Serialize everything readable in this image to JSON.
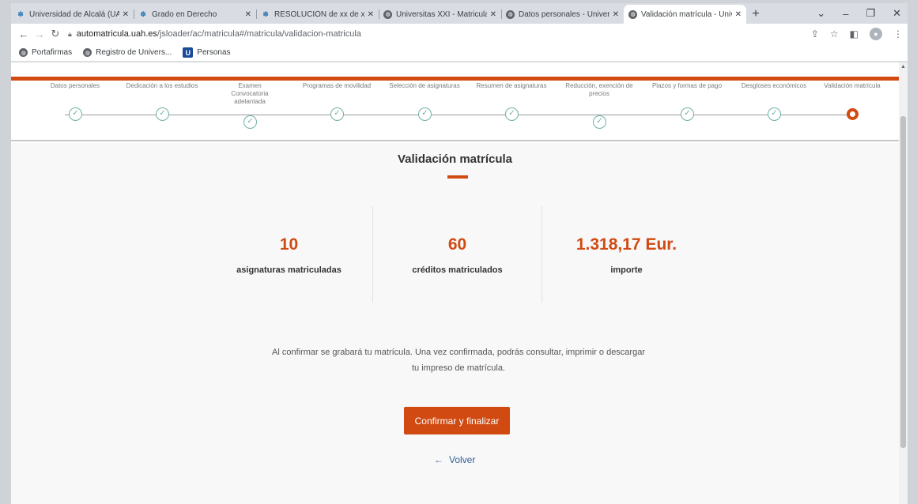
{
  "browser": {
    "tabs": [
      {
        "title": "Universidad de Alcalá (UAH) |",
        "icon": "uah-logo-icon",
        "active": false
      },
      {
        "title": "Grado en Derecho",
        "icon": "uah-logo-icon",
        "active": false
      },
      {
        "title": "RESOLUCIÓN de xx de xx de",
        "icon": "uah-logo-icon",
        "active": false
      },
      {
        "title": "Universitas XXI - Matricula W",
        "icon": "globe-icon",
        "active": false
      },
      {
        "title": "Datos personales - Universit",
        "icon": "globe-icon",
        "active": false
      },
      {
        "title": "Validación matrícula - Univer",
        "icon": "globe-icon",
        "active": true
      }
    ],
    "url_host": "automatricula.uah.es",
    "url_path": "/jsloader/ac/matricula#/matricula/validacion-matricula",
    "bookmarks": [
      {
        "label": "Portafirmas",
        "icon": "globe-icon"
      },
      {
        "label": "Registro de Univers...",
        "icon": "globe-icon"
      },
      {
        "label": "Personas",
        "icon": "u-logo-icon"
      }
    ]
  },
  "steps": [
    {
      "label": "Datos personales",
      "status": "done"
    },
    {
      "label": "Dedicación a los estudios",
      "status": "done"
    },
    {
      "label": "Examen Convocatoria adelantada",
      "status": "done"
    },
    {
      "label": "Programas de movilidad",
      "status": "done"
    },
    {
      "label": "Selección de asignaturas",
      "status": "done"
    },
    {
      "label": "Resumen de asignaturas",
      "status": "done"
    },
    {
      "label": "Reducción, exención de precios",
      "status": "done"
    },
    {
      "label": "Plazos y formas de pago",
      "status": "done"
    },
    {
      "label": "Desgloses económicos",
      "status": "done"
    },
    {
      "label": "Validación matrícula",
      "status": "current"
    }
  ],
  "page": {
    "title": "Validación matrícula",
    "stats": [
      {
        "value": "10",
        "label": "asignaturas matriculadas"
      },
      {
        "value": "60",
        "label": "créditos matriculados"
      },
      {
        "value": "1.318,17 Eur.",
        "label": "importe"
      }
    ],
    "notice_line1": "Al confirmar se grabará tu matrícula. Una vez confirmada, podrás consultar, imprimir o descargar",
    "notice_line2": "tu impreso de matrícula.",
    "confirm_label": "Confirmar y finalizar",
    "back_label": "Volver"
  },
  "colors": {
    "accent": "#d04a12",
    "step_done": "#6fb0a4",
    "link": "#2f5f96"
  }
}
